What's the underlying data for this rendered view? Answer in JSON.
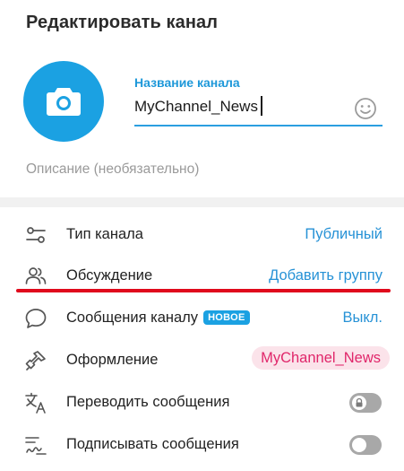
{
  "header": {
    "title": "Редактировать канал"
  },
  "avatar": {
    "icon": "camera-icon",
    "color": "#1ba1e2"
  },
  "name_field": {
    "label": "Название канала",
    "value": "MyChannel_News",
    "emoji_icon": "smile-icon",
    "accent": "#2b9fe0"
  },
  "description": {
    "placeholder": "Описание (необязательно)"
  },
  "settings": {
    "channel_type": {
      "label": "Тип канала",
      "value": "Публичный",
      "icon": "sliders-icon"
    },
    "discussion": {
      "label": "Обсуждение",
      "value": "Добавить группу",
      "icon": "people-icon"
    },
    "channel_messages": {
      "label": "Сообщения каналу",
      "badge": "НОВОЕ",
      "value": "Выкл.",
      "icon": "chat-bubble-icon"
    },
    "appearance": {
      "label": "Оформление",
      "value": "MyChannel_News",
      "icon": "brush-icon",
      "pill_color": "#e0266a"
    },
    "translate": {
      "label": "Переводить сообщения",
      "toggle_on": false,
      "locked": true,
      "icon": "translate-icon"
    },
    "sign": {
      "label": "Подписывать сообщения",
      "toggle_on": false,
      "icon": "signature-icon"
    }
  },
  "highlight": {
    "color": "#e00a1c",
    "target": "discussion"
  }
}
